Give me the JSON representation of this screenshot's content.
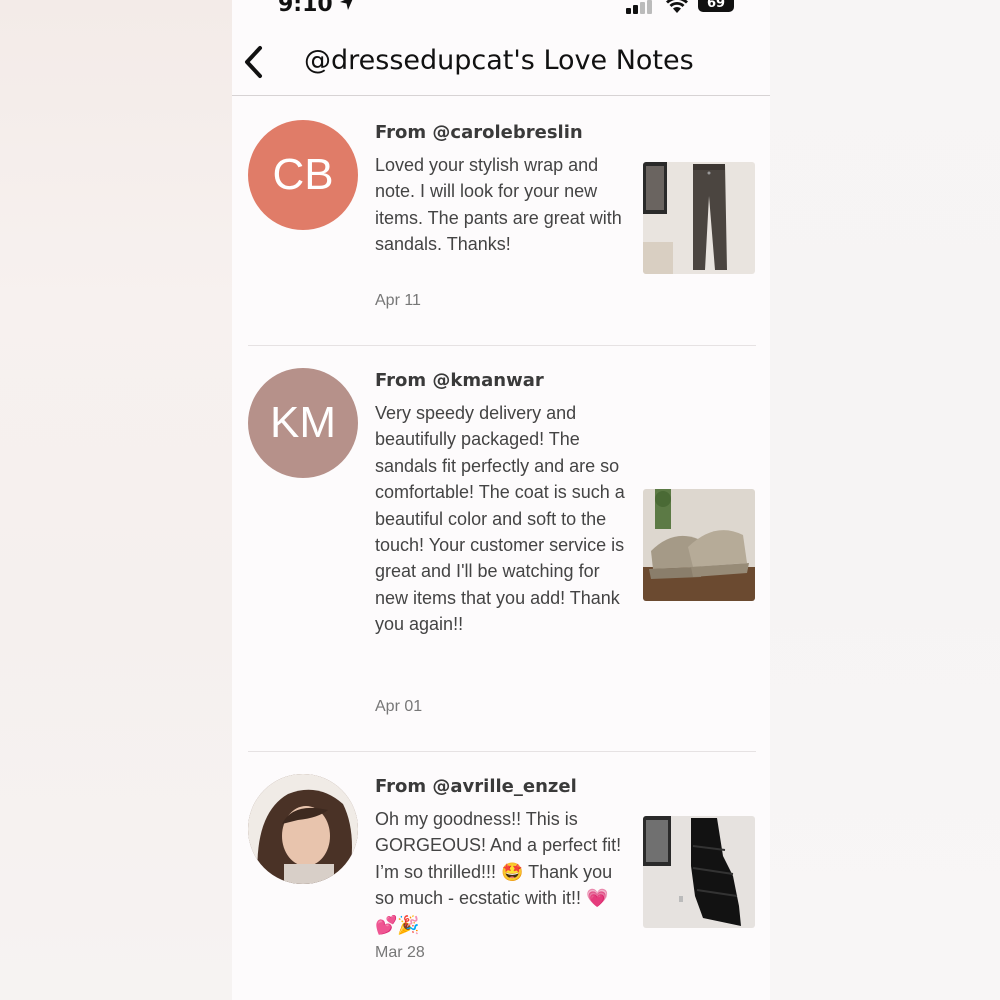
{
  "status_bar": {
    "time": "9:10",
    "battery": "69"
  },
  "header": {
    "title": "@dressedupcat's Love Notes"
  },
  "notes": [
    {
      "initials": "CB",
      "avatar_color": "#e07c68",
      "from": "From @carolebreslin",
      "message": "Loved your stylish wrap and note. I will look for your new items. The pants are great with sandals. Thanks!",
      "date": "Apr 11",
      "thumb": "pants"
    },
    {
      "initials": "KM",
      "avatar_color": "#b6918a",
      "from": "From @kmanwar",
      "message": "Very speedy delivery and beautifully packaged! The sandals fit perfectly and are so comfortable! The coat is such a beautiful color and soft to the touch! Your customer service is great and I'll be watching for new items that you add! Thank you again!!",
      "date": "Apr 01",
      "thumb": "sandals"
    },
    {
      "initials": "",
      "avatar_color": "#6b4a3a",
      "from": "From @avrille_enzel",
      "message": "Oh my goodness!! This is GORGEOUS! And a perfect fit! I’m so thrilled!!! 🤩 Thank you so much - ecstatic with it!! 💗💕🎉",
      "date": "Mar 28",
      "thumb": "skirt"
    }
  ]
}
